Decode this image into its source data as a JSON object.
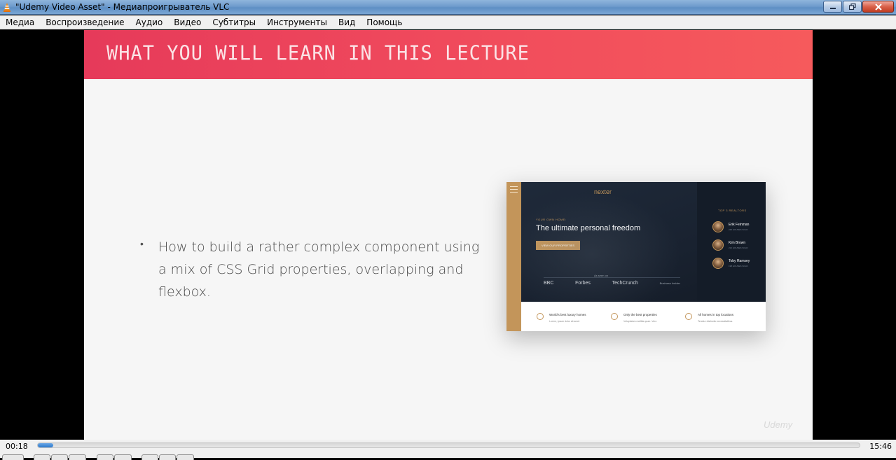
{
  "window": {
    "title": "\"Udemy Video Asset\" - Медиапроигрыватель VLC",
    "app_icon": "vlc-cone-icon",
    "buttons": [
      "minimize-icon",
      "restore-icon",
      "close-icon"
    ]
  },
  "menu": {
    "items": [
      "Медиа",
      "Воспроизведение",
      "Аудио",
      "Видео",
      "Субтитры",
      "Инструменты",
      "Вид",
      "Помощь"
    ]
  },
  "slide": {
    "title": "WHAT YOU WILL LEARN IN THIS LECTURE",
    "bullet_marker": "•",
    "bullet_text": "How to build a rather complex component using a mix of CSS Grid properties, overlapping and flexbox.",
    "header_colors": [
      "#e63a5a",
      "#f65a5c"
    ],
    "mock": {
      "logo": "nexter",
      "eyebrow": "YOUR OWN HOME:",
      "headline": "The ultimate personal freedom",
      "cta": "VIEW OUR PROPERTIES",
      "seen_on": "As seen on",
      "brands": [
        "BBC",
        "Forbes",
        "TechCrunch",
        "Business Insider"
      ],
      "realtors_title": "TOP 3 REALTORS",
      "realtors": [
        {
          "name": "Erik Feinman",
          "sub": "245 HOUSES SOLD"
        },
        {
          "name": "Kim Brown",
          "sub": "212 HOUSES SOLD"
        },
        {
          "name": "Toby Ramsey",
          "sub": "198 HOUSES SOLD"
        }
      ],
      "features": [
        {
          "title": "World's best luxury homes",
          "sub": "Lorem, ipsum dolor sit amet"
        },
        {
          "title": "Only the best properties",
          "sub": "Voluptatum mollitia quae. Vero"
        },
        {
          "title": "All homes in top locations",
          "sub": "Tenetur distinctio necessitatibus"
        }
      ]
    },
    "watermark": "Udemy"
  },
  "player": {
    "current_time": "00:18",
    "total_time": "15:46",
    "progress": 0.019
  }
}
